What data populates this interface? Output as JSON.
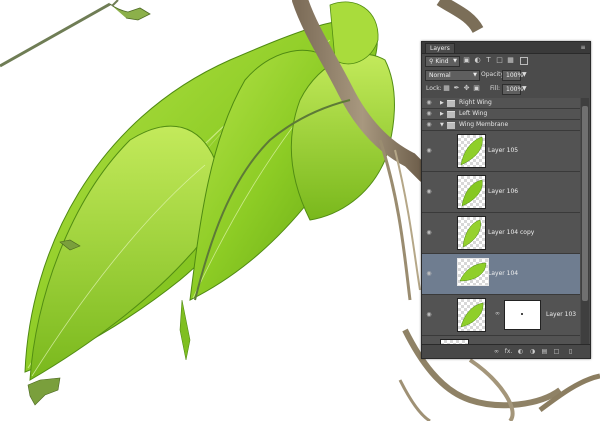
{
  "panel": {
    "tab_title": "Layers",
    "menu_icon": "panel-menu-icon",
    "filter": {
      "kind": "Kind",
      "filter_icons": [
        "image-filter-icon",
        "adjustment-filter-icon",
        "type-filter-icon",
        "shape-filter-icon",
        "smart-object-filter-icon"
      ]
    },
    "blend_mode": "Normal",
    "opacity_label": "Opacity:",
    "opacity_value": "100%",
    "lock_label": "Lock:",
    "fill_label": "Fill:",
    "fill_value": "100%",
    "groups": [
      "Right Wing",
      "Left Wing",
      "Wing Membrane"
    ],
    "layers": [
      "Layer 105",
      "Layer 106",
      "Layer 104 copy",
      "Layer 104",
      "Layer 103"
    ],
    "selected_layer": "Layer 104",
    "bottom_icons": [
      "link-layers-icon",
      "fx-icon",
      "add-mask-icon",
      "adjustment-layer-icon",
      "new-group-icon",
      "new-layer-icon",
      "trash-icon"
    ],
    "fx_text": "fx."
  },
  "colors": {
    "panel_bg": "#4b4b4b",
    "selected_row": "#6f7d90",
    "leaf_green": "#8fcf2a"
  }
}
